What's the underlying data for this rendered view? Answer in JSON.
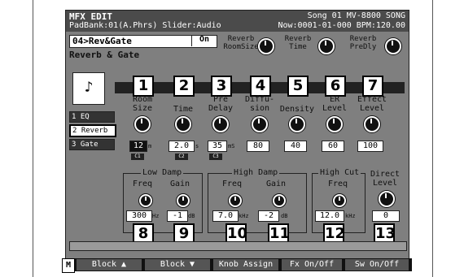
{
  "header": {
    "title": "MFX EDIT",
    "song": "Song 01 MV-8800 SONG",
    "padbank": "PadBank:01(A.Phrs) Slider:Audio",
    "now": "Now:0001-01-000  BPM:120.00"
  },
  "patch": {
    "name": "04>Rev&Gate",
    "onoff": "On"
  },
  "algorithm": "Reverb & Gate",
  "quick_knobs": [
    {
      "label": "Reverb\nRoomSize"
    },
    {
      "label": "Reverb\nTime"
    },
    {
      "label": "Reverb\nPreDly"
    }
  ],
  "blocks": [
    "1 EQ",
    "2 Reverb",
    "3 Gate"
  ],
  "params": [
    {
      "num": "1",
      "label": "Room\nSize",
      "value": "12",
      "unit": "m",
      "tag": "C1"
    },
    {
      "num": "2",
      "label": "Time",
      "value": "2.0",
      "unit": "s",
      "tag": "C2"
    },
    {
      "num": "3",
      "label": "Pre\nDelay",
      "value": "35",
      "unit": "mS",
      "tag": "C3"
    },
    {
      "num": "4",
      "label": "Diffu-\nsion",
      "value": "80"
    },
    {
      "num": "5",
      "label": "Density",
      "value": "40"
    },
    {
      "num": "6",
      "label": "ER\nLevel",
      "value": "60"
    },
    {
      "num": "7",
      "label": "Effect\nLevel",
      "value": "100"
    }
  ],
  "bottom_sections": {
    "low_damp": {
      "title": "Low Damp",
      "freq_label": "Freq",
      "gain_label": "Gain",
      "freq": "300",
      "freq_unit": "Hz",
      "gain": "-1",
      "gain_unit": "dB"
    },
    "high_damp": {
      "title": "High Damp",
      "freq_label": "Freq",
      "gain_label": "Gain",
      "freq": "7.0",
      "freq_unit": "kHz",
      "gain": "-2",
      "gain_unit": "dB"
    },
    "high_cut": {
      "title": "High Cut",
      "freq_label": "Freq",
      "freq": "12.0",
      "freq_unit": "kHz"
    },
    "direct": {
      "label": "Direct\nLevel",
      "value": "0"
    }
  },
  "bottom_numbers": [
    "8",
    "9",
    "10",
    "11",
    "12",
    "13"
  ],
  "function_bar": {
    "m": "M",
    "buttons": [
      "Block ▲",
      "Block ▼",
      "Knob Assign",
      "Fx On/Off",
      "Sw On/Off"
    ]
  }
}
